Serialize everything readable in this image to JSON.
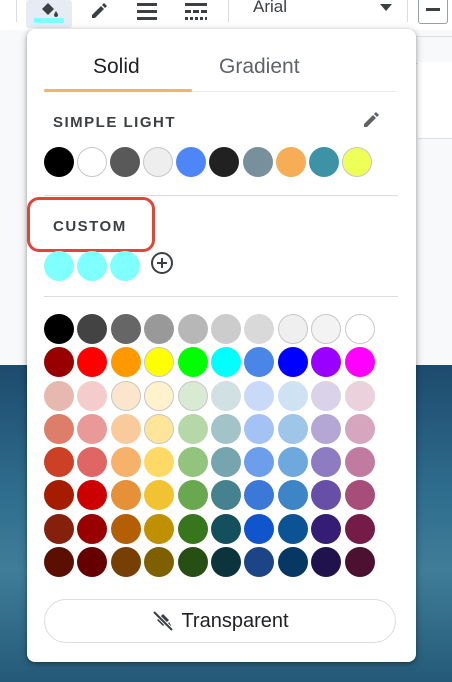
{
  "toolbar": {
    "font_name": "Arial",
    "fill_color": "#80ffff"
  },
  "popup": {
    "tabs": [
      {
        "label": "Solid",
        "active": true
      },
      {
        "label": "Gradient",
        "active": false
      }
    ],
    "simple_light": {
      "label": "SIMPLE LIGHT",
      "colors": [
        "#000000",
        "#ffffff",
        "#595959",
        "#eeeeee",
        "#4f86f7",
        "#212121",
        "#78909c",
        "#f6ad55",
        "#3d93a5",
        "#eeff58"
      ]
    },
    "custom": {
      "label": "CUSTOM",
      "colors": [
        "#80ffff",
        "#80ffff",
        "#80ffff"
      ],
      "highlight_color": "#e0453a"
    },
    "palette": [
      [
        "#000000",
        "#434343",
        "#666666",
        "#999999",
        "#b7b7b7",
        "#cccccc",
        "#d9d9d9",
        "#efefef",
        "#f3f3f3",
        "#ffffff"
      ],
      [
        "#980000",
        "#ff0000",
        "#ff9900",
        "#ffff00",
        "#00ff00",
        "#00ffff",
        "#4a86e8",
        "#0000ff",
        "#9900ff",
        "#ff00ff"
      ],
      [
        "#e6b8af",
        "#f4cccc",
        "#fce5cd",
        "#fff2cc",
        "#d9ead3",
        "#d0e0e3",
        "#c9daf8",
        "#cfe2f3",
        "#d9d2e9",
        "#ead1dc"
      ],
      [
        "#dd7e6b",
        "#ea9999",
        "#f9cb9c",
        "#ffe599",
        "#b6d7a8",
        "#a2c4c9",
        "#a4c2f4",
        "#9fc5e8",
        "#b4a7d6",
        "#d5a6bd"
      ],
      [
        "#cc4125",
        "#e06666",
        "#f6b26b",
        "#ffd966",
        "#93c47d",
        "#76a5af",
        "#6d9eeb",
        "#6fa8dc",
        "#8e7cc3",
        "#c27ba0"
      ],
      [
        "#a61c00",
        "#cc0000",
        "#e69138",
        "#f1c232",
        "#6aa84f",
        "#45818e",
        "#3c78d8",
        "#3d85c6",
        "#674ea7",
        "#a64d79"
      ],
      [
        "#85200c",
        "#990000",
        "#b45f06",
        "#bf9000",
        "#38761d",
        "#134f5c",
        "#1155cc",
        "#0b5394",
        "#351c75",
        "#741b47"
      ],
      [
        "#5b0f00",
        "#660000",
        "#783f04",
        "#7f6000",
        "#274e13",
        "#0c343d",
        "#1c4587",
        "#073763",
        "#20124d",
        "#4c1130"
      ]
    ],
    "transparent_label": "Transparent"
  }
}
